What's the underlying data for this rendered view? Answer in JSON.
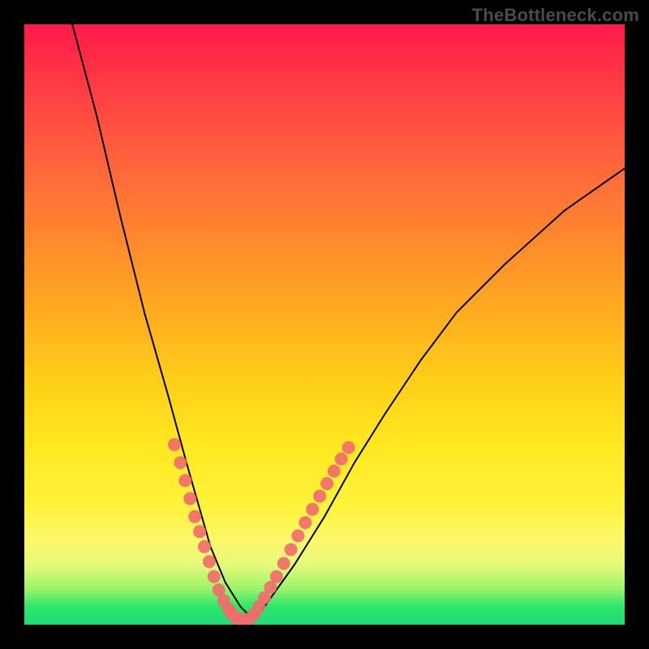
{
  "watermark": "TheBottleneck.com",
  "chart_data": {
    "type": "line",
    "title": "",
    "xlabel": "",
    "ylabel": "",
    "xlim": [
      0,
      100
    ],
    "ylim": [
      0,
      100
    ],
    "grid": false,
    "series": [
      {
        "name": "bottleneck-curve",
        "x": [
          8,
          12,
          16,
          20,
          24,
          27,
          29,
          31,
          33.5,
          36,
          38,
          40,
          45,
          50,
          55,
          60,
          66,
          72,
          80,
          90,
          100
        ],
        "y": [
          100,
          85,
          68,
          52,
          38,
          27,
          20,
          13,
          7,
          3,
          1,
          3,
          10,
          18,
          27,
          35,
          44,
          52,
          60,
          69,
          76
        ]
      }
    ],
    "markers": [
      {
        "name": "cluster-left",
        "color": "#f16d6d",
        "points": [
          {
            "x": 25.0,
            "y": 30
          },
          {
            "x": 26.0,
            "y": 27
          },
          {
            "x": 26.8,
            "y": 24
          },
          {
            "x": 27.6,
            "y": 21
          },
          {
            "x": 28.4,
            "y": 18
          },
          {
            "x": 29.2,
            "y": 15.5
          },
          {
            "x": 30.0,
            "y": 13
          },
          {
            "x": 30.8,
            "y": 10.5
          },
          {
            "x": 31.6,
            "y": 8
          },
          {
            "x": 32.4,
            "y": 5.8
          },
          {
            "x": 33.2,
            "y": 4
          },
          {
            "x": 34.0,
            "y": 2.6
          },
          {
            "x": 34.6,
            "y": 1.8
          },
          {
            "x": 35.2,
            "y": 1.2
          },
          {
            "x": 35.8,
            "y": 0.9
          },
          {
            "x": 36.4,
            "y": 0.8
          }
        ]
      },
      {
        "name": "cluster-right",
        "color": "#f16d6d",
        "points": [
          {
            "x": 37.5,
            "y": 1.0
          },
          {
            "x": 38.3,
            "y": 1.8
          },
          {
            "x": 39.1,
            "y": 3.0
          },
          {
            "x": 40.0,
            "y": 4.5
          },
          {
            "x": 41.0,
            "y": 6.2
          },
          {
            "x": 42.0,
            "y": 8.0
          },
          {
            "x": 43.2,
            "y": 10.2
          },
          {
            "x": 44.4,
            "y": 12.5
          },
          {
            "x": 45.6,
            "y": 14.8
          },
          {
            "x": 46.8,
            "y": 17.0
          },
          {
            "x": 48.0,
            "y": 19.2
          },
          {
            "x": 49.2,
            "y": 21.4
          },
          {
            "x": 50.4,
            "y": 23.5
          },
          {
            "x": 51.6,
            "y": 25.6
          },
          {
            "x": 52.8,
            "y": 27.6
          },
          {
            "x": 54.0,
            "y": 29.5
          }
        ]
      }
    ],
    "background_gradient": {
      "top": "#ff1a47",
      "upper_mid": "#ffa322",
      "mid": "#ffe820",
      "lower_mid": "#fcf86a",
      "bottom": "#1edc78"
    }
  }
}
